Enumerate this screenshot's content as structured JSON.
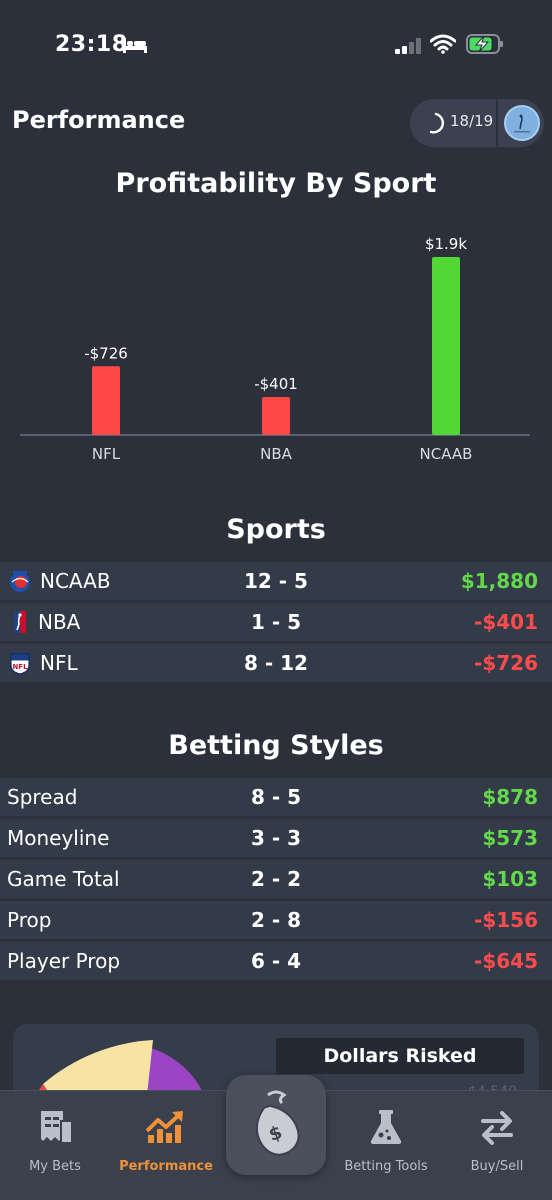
{
  "status_bar": {
    "time": "23:18"
  },
  "header": {
    "title": "Performance",
    "progress": "18/19"
  },
  "chart_data": {
    "type": "bar",
    "title": "Profitability By Sport",
    "categories": [
      "NFL",
      "NBA",
      "NCAAB"
    ],
    "values": [
      -726,
      -401,
      1880
    ],
    "data_labels": [
      "-$726",
      "-$401",
      "$1.9k"
    ],
    "colors": {
      "negative": "#ff4848",
      "positive": "#52d835"
    }
  },
  "sports": {
    "title": "Sports",
    "rows": [
      {
        "name": "NCAAB",
        "record": "12 - 5",
        "profit": "$1,880",
        "positive": true,
        "logo": "ncaa-logo"
      },
      {
        "name": "NBA",
        "record": "1 - 5",
        "profit": "-$401",
        "positive": false,
        "logo": "nba-logo"
      },
      {
        "name": "NFL",
        "record": "8 - 12",
        "profit": "-$726",
        "positive": false,
        "logo": "nfl-logo"
      }
    ]
  },
  "betting_styles": {
    "title": "Betting Styles",
    "rows": [
      {
        "name": "Spread",
        "record": "8 - 5",
        "profit": "$878",
        "positive": true
      },
      {
        "name": "Moneyline",
        "record": "3 - 3",
        "profit": "$573",
        "positive": true
      },
      {
        "name": "Game Total",
        "record": "2 - 2",
        "profit": "$103",
        "positive": true
      },
      {
        "name": "Prop",
        "record": "2 - 8",
        "profit": "-$156",
        "positive": false
      },
      {
        "name": "Player Prop",
        "record": "6 - 4",
        "profit": "-$645",
        "positive": false
      }
    ]
  },
  "dollars_risked": {
    "title": "Dollars Risked",
    "peek_value": "$4,540"
  },
  "tabs": [
    {
      "label": "My Bets",
      "icon": "receipt-icon",
      "active": false
    },
    {
      "label": "Performance",
      "icon": "trending-up-icon",
      "active": true
    },
    {
      "label": "Betting Tools",
      "icon": "flask-icon",
      "active": false
    },
    {
      "label": "Buy/Sell",
      "icon": "swap-icon",
      "active": false
    }
  ]
}
